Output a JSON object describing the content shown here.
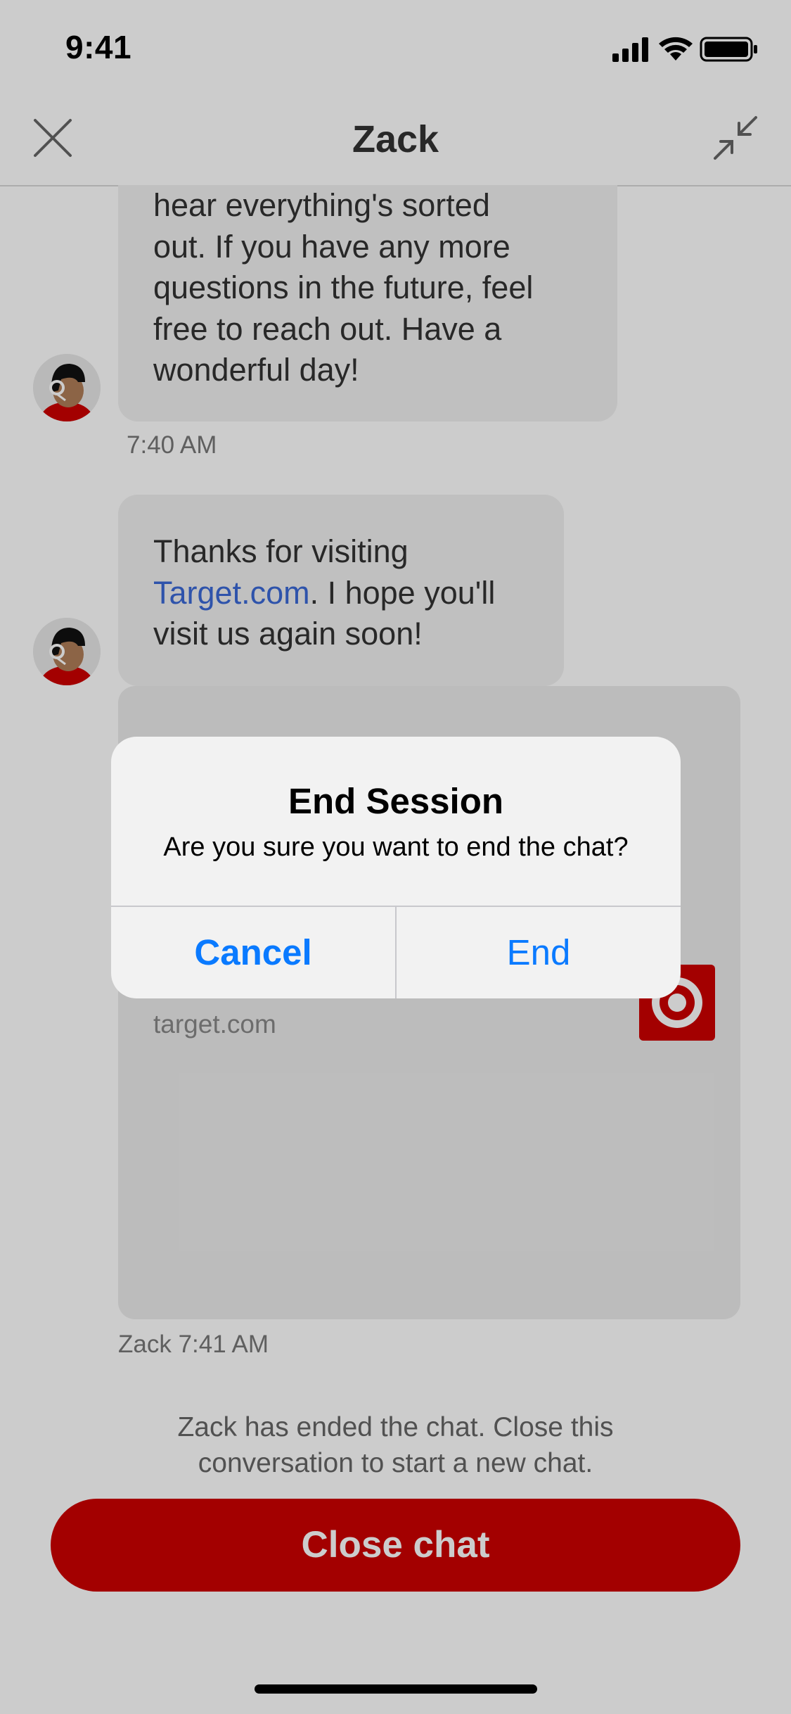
{
  "status_bar": {
    "time": "9:41"
  },
  "header": {
    "title": "Zack",
    "close_icon": "close-icon",
    "minimize_icon": "minimize-icon"
  },
  "messages": [
    {
      "lines": [
        "hear everything's sorted",
        "out. If you have any more",
        "questions in the future, feel",
        "free to reach out. Have a",
        "wonderful day!"
      ],
      "time": "7:40 AM"
    },
    {
      "text_before": "Thanks for visiting ",
      "link": "Target.com",
      "text_after": ". I hope you'll visit us again soon!"
    }
  ],
  "card": {
    "domain": "target.com",
    "logo": "target-logo"
  },
  "card_footer": "Zack 7:41 AM",
  "system_message": {
    "line1": "Zack has ended the chat. Close this",
    "line2": "conversation to start a new chat."
  },
  "close_chat_label": "Close chat",
  "alert": {
    "title": "End Session",
    "message": "Are you sure you want to end the chat?",
    "cancel_label": "Cancel",
    "end_label": "End"
  },
  "colors": {
    "brand_red": "#cc0000",
    "ios_blue": "#0a7aff",
    "link_blue": "#3a68d6"
  }
}
